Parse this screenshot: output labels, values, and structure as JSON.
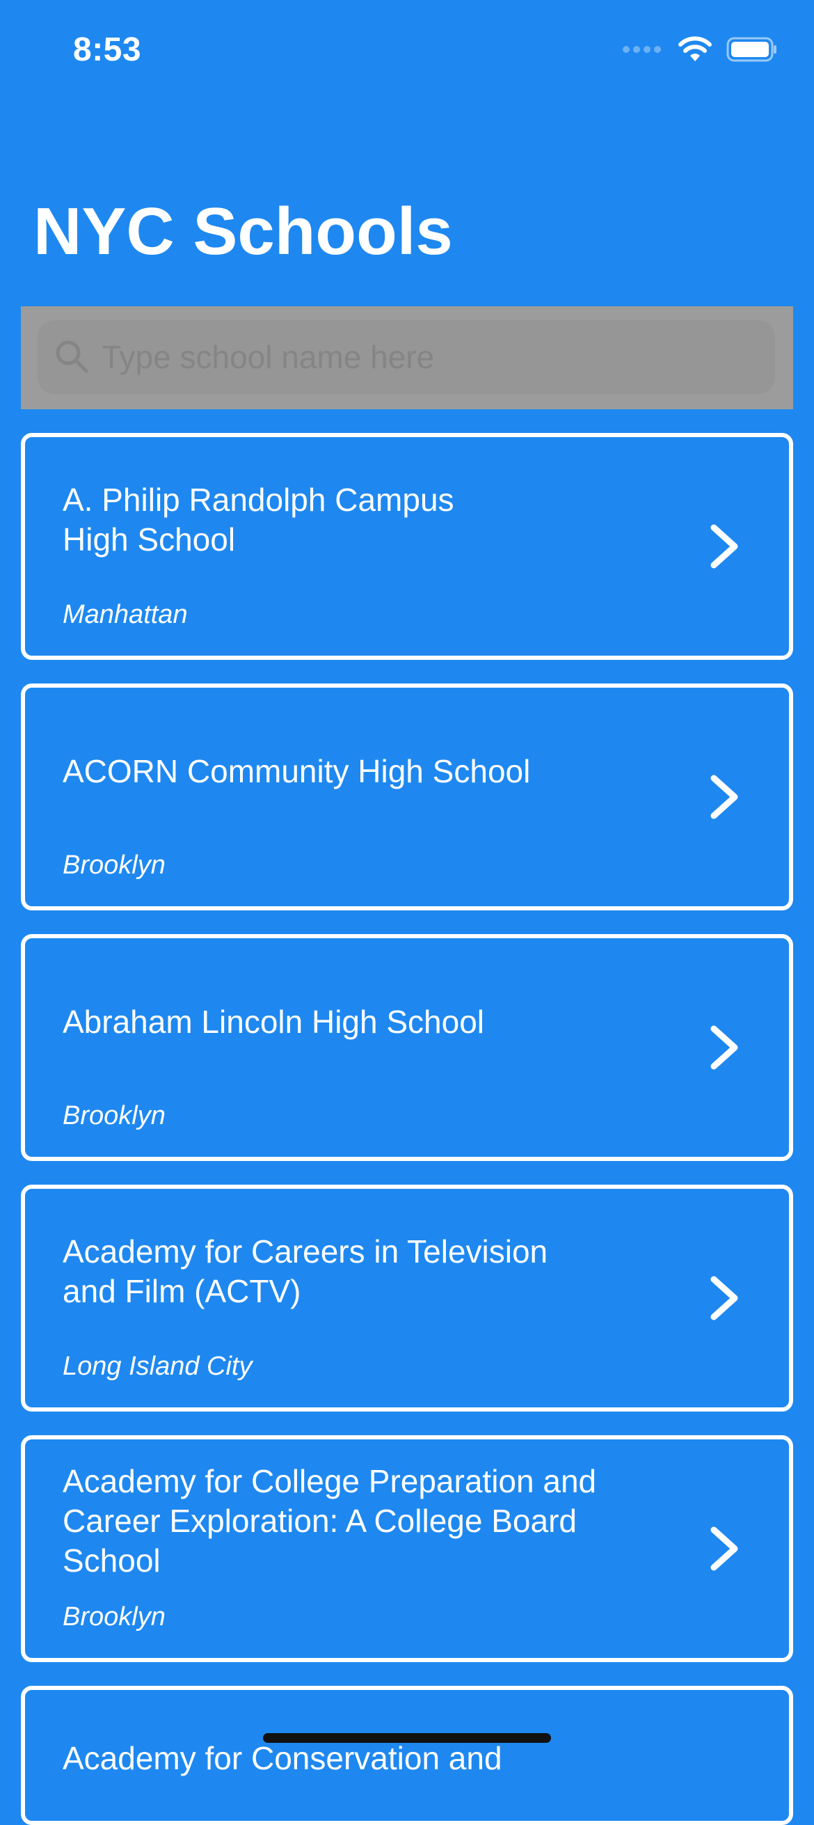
{
  "status_bar": {
    "time": "8:53",
    "icons": [
      "signal-icon",
      "wifi-icon",
      "battery-icon"
    ]
  },
  "header": {
    "title": "NYC Schools"
  },
  "search": {
    "placeholder": "Type school name here",
    "value": "",
    "icon": "search-icon"
  },
  "schools": [
    {
      "name": "A. Philip Randolph Campus High School",
      "borough": "Manhattan"
    },
    {
      "name": "ACORN Community High School",
      "borough": "Brooklyn"
    },
    {
      "name": "Abraham Lincoln High School",
      "borough": "Brooklyn"
    },
    {
      "name": "Academy for Careers in Television and Film (ACTV)",
      "borough": "Long Island City"
    },
    {
      "name": "Academy for College Preparation and Career Exploration: A College Board School",
      "borough": "Brooklyn"
    },
    {
      "name": "Academy for Conservation and",
      "borough": ""
    }
  ],
  "colors": {
    "background": "#1e88f0",
    "card_border": "#ffffff",
    "search_bar": "#9c9c9c"
  }
}
